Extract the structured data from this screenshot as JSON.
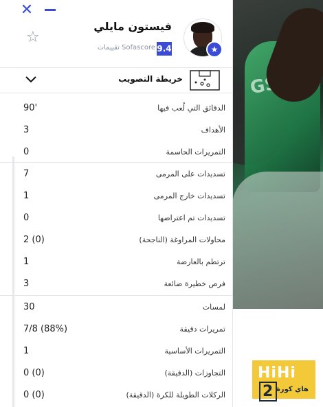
{
  "header": {
    "close_symbol": "✕",
    "player_name": "فيستون مايلي",
    "rating": "9.4",
    "rating_caption": "تقييمات Sofascore",
    "favorite_symbol": "☆",
    "verified_symbol": "★"
  },
  "shotmap": {
    "label": "خريطة التصويب",
    "chevron_icon": "chevron-down-icon",
    "pitch_icon": "pitch-icon"
  },
  "stats": [
    {
      "label": "الدقائق التي لُعب فيها",
      "value": "90'"
    },
    {
      "label": "الأهداف",
      "value": "3"
    },
    {
      "label": "التمريرات الحاسمة",
      "value": "0"
    },
    {
      "label": "تسديدات على المرمى",
      "value": "7"
    },
    {
      "label": "تسديدات خارج المرمى",
      "value": "1"
    },
    {
      "label": "تسديدات تم اعتراضها",
      "value": "0"
    },
    {
      "label": "محاولات المراوغة (الناجحة)",
      "value": "2 (0)"
    },
    {
      "label": "ترتطم بالعارضة",
      "value": "1"
    },
    {
      "label": "فرص خطيرة ضائعة",
      "value": "3"
    },
    {
      "label": "لمسات",
      "value": "30"
    },
    {
      "label": "تمريرات دقيقة",
      "value": "7/8 (88%)"
    },
    {
      "label": "التمريرات الأساسية",
      "value": "1"
    },
    {
      "label": "التجاوزات (الدقيقة)",
      "value": "0 (0)"
    },
    {
      "label": "الركلات الطويلة للكرة (الدقيقة)",
      "value": "0 (0)"
    }
  ],
  "background": {
    "jersey_text": "GS"
  },
  "logo": {
    "main": "HiHi",
    "number": "2",
    "sub": "هاي كورة"
  },
  "colors": {
    "accent": "#3a4bd6",
    "logo_bg": "#f3c93a"
  }
}
